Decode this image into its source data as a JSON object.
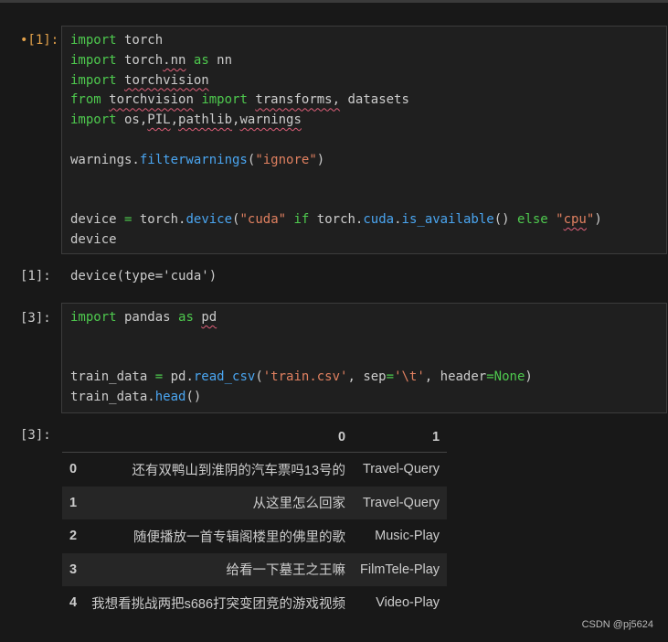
{
  "cells": [
    {
      "prompt": "•[1]:",
      "lines": [
        "import torch",
        "import torch.nn as nn",
        "import torchvision",
        "from torchvision import transforms, datasets",
        "import os,PIL,pathlib,warnings",
        "",
        "warnings.filterwarnings(\"ignore\")",
        "",
        "",
        "device = torch.device(\"cuda\" if torch.cuda.is_available() else \"cpu\")",
        "device"
      ]
    },
    {
      "prompt": "[3]:",
      "lines": [
        "import pandas as pd",
        "",
        "",
        "train_data = pd.read_csv('train.csv', sep='\\t', header=None)",
        "train_data.head()"
      ]
    }
  ],
  "outputs": [
    {
      "prompt": "[1]:",
      "text": "device(type='cuda')"
    },
    {
      "prompt": "[3]:"
    }
  ],
  "dataframe": {
    "columns": [
      "",
      "0",
      "1"
    ],
    "rows": [
      {
        "index": "0",
        "c0": "还有双鸭山到淮阴的汽车票吗13号的",
        "c1": "Travel-Query"
      },
      {
        "index": "1",
        "c0": "从这里怎么回家",
        "c1": "Travel-Query"
      },
      {
        "index": "2",
        "c0": "随便播放一首专辑阁楼里的佛里的歌",
        "c1": "Music-Play"
      },
      {
        "index": "3",
        "c0": "给看一下墓王之王嘛",
        "c1": "FilmTele-Play"
      },
      {
        "index": "4",
        "c0": "我想看挑战两把s686打突变团竞的游戏视频",
        "c1": "Video-Play"
      }
    ]
  },
  "watermark": "CSDN @pj5624",
  "colors": {
    "keyword": "#4ec94e",
    "function": "#4aa5f0",
    "string": "#e08060",
    "active_prompt": "#e3a14a"
  }
}
